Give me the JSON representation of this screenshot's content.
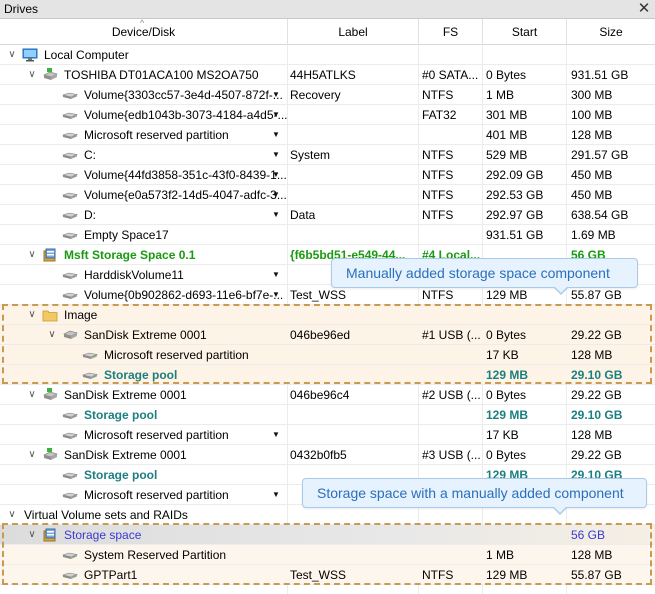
{
  "panel": {
    "title": "Drives"
  },
  "header": {
    "columns": [
      "Device/Disk",
      "Label",
      "FS",
      "Start",
      "Size"
    ]
  },
  "rows": [
    {
      "expand": "collapse",
      "level": 0,
      "icon": "computer-icon",
      "name": "Local Computer",
      "label": "",
      "fs": "",
      "start": "",
      "size": "",
      "style": "",
      "dropdown": false
    },
    {
      "expand": "collapse",
      "level": 1,
      "icon": "disk-green-icon",
      "name": "TOSHIBA DT01ACA100 MS2OA750",
      "label": "44H5ATLKS",
      "fs": "#0 SATA...",
      "start": "0 Bytes",
      "size": "931.51 GB",
      "style": "",
      "dropdown": false
    },
    {
      "expand": "",
      "level": 2,
      "icon": "volume-icon",
      "name": "Volume{3303cc57-3e4d-4507-872f-...",
      "label": "Recovery",
      "fs": "NTFS",
      "start": "1 MB",
      "size": "300 MB",
      "style": "",
      "dropdown": true
    },
    {
      "expand": "",
      "level": 2,
      "icon": "volume-icon",
      "name": "Volume{edb1043b-3073-4184-a4d5-...",
      "label": "",
      "fs": "FAT32",
      "start": "301 MB",
      "size": "100 MB",
      "style": "",
      "dropdown": true
    },
    {
      "expand": "",
      "level": 2,
      "icon": "volume-icon",
      "name": "Microsoft reserved partition",
      "label": "",
      "fs": "",
      "start": "401 MB",
      "size": "128 MB",
      "style": "",
      "dropdown": true
    },
    {
      "expand": "",
      "level": 2,
      "icon": "volume-icon",
      "name": "C:",
      "label": "System",
      "fs": "NTFS",
      "start": "529 MB",
      "size": "291.57 GB",
      "style": "",
      "dropdown": true
    },
    {
      "expand": "",
      "level": 2,
      "icon": "volume-icon",
      "name": "Volume{44fd3858-351c-43f0-8439-1...",
      "label": "",
      "fs": "NTFS",
      "start": "292.09 GB",
      "size": "450 MB",
      "style": "",
      "dropdown": true
    },
    {
      "expand": "",
      "level": 2,
      "icon": "volume-icon",
      "name": "Volume{e0a573f2-14d5-4047-adfc-3...",
      "label": "",
      "fs": "NTFS",
      "start": "292.53 GB",
      "size": "450 MB",
      "style": "",
      "dropdown": true
    },
    {
      "expand": "",
      "level": 2,
      "icon": "volume-icon",
      "name": "D:",
      "label": "Data",
      "fs": "NTFS",
      "start": "292.97 GB",
      "size": "638.54 GB",
      "style": "",
      "dropdown": true
    },
    {
      "expand": "",
      "level": 2,
      "icon": "volume-icon",
      "name": "Empty Space17",
      "label": "",
      "fs": "",
      "start": "931.51 GB",
      "size": "1.69 MB",
      "style": "",
      "dropdown": false
    },
    {
      "expand": "collapse",
      "level": 1,
      "icon": "storage-space-icon",
      "name": "Msft Storage Space 0.1",
      "label": "{f6b5bd51-e549-44...",
      "fs": "#4 Local...",
      "start": "",
      "size": "56 GB",
      "style": "green",
      "dropdown": false
    },
    {
      "expand": "",
      "level": 2,
      "icon": "volume-icon",
      "name": "HarddiskVolume11",
      "label": "",
      "fs": "",
      "start": "",
      "size": "",
      "style": "",
      "dropdown": true
    },
    {
      "expand": "",
      "level": 2,
      "icon": "volume-icon",
      "name": "Volume{0b902862-d693-11e6-bf7e-...",
      "label": "Test_WSS",
      "fs": "NTFS",
      "start": "129 MB",
      "size": "55.87 GB",
      "style": "",
      "dropdown": true
    },
    {
      "expand": "collapse",
      "level": 1,
      "icon": "folder-icon",
      "name": "Image",
      "label": "",
      "fs": "",
      "start": "",
      "size": "",
      "style": "",
      "dropdown": false
    },
    {
      "expand": "collapse",
      "level": 2,
      "icon": "disk-icon",
      "name": "SanDisk Extreme 0001",
      "label": "046be96ed",
      "fs": "#1 USB (...",
      "start": "0 Bytes",
      "size": "29.22 GB",
      "style": "",
      "dropdown": false
    },
    {
      "expand": "",
      "level": 3,
      "icon": "volume-icon",
      "name": "Microsoft reserved partition",
      "label": "",
      "fs": "",
      "start": "17 KB",
      "size": "128 MB",
      "style": "",
      "dropdown": false
    },
    {
      "expand": "",
      "level": 3,
      "icon": "volume-icon",
      "name": "Storage pool",
      "label": "",
      "fs": "",
      "start": "129 MB",
      "size": "29.10 GB",
      "style": "teal",
      "dropdown": false
    },
    {
      "expand": "collapse",
      "level": 1,
      "icon": "disk-green-icon",
      "name": "SanDisk Extreme 0001",
      "label": "046be96c4",
      "fs": "#2 USB (...",
      "start": "0 Bytes",
      "size": "29.22 GB",
      "style": "",
      "dropdown": false
    },
    {
      "expand": "",
      "level": 2,
      "icon": "volume-icon",
      "name": "Storage pool",
      "label": "",
      "fs": "",
      "start": "129 MB",
      "size": "29.10 GB",
      "style": "teal",
      "dropdown": false
    },
    {
      "expand": "",
      "level": 2,
      "icon": "volume-icon",
      "name": "Microsoft reserved partition",
      "label": "",
      "fs": "",
      "start": "17 KB",
      "size": "128 MB",
      "style": "",
      "dropdown": true
    },
    {
      "expand": "collapse",
      "level": 1,
      "icon": "disk-green-icon",
      "name": "SanDisk Extreme 0001",
      "label": "0432b0fb5",
      "fs": "#3 USB (...",
      "start": "0 Bytes",
      "size": "29.22 GB",
      "style": "",
      "dropdown": false
    },
    {
      "expand": "",
      "level": 2,
      "icon": "volume-icon",
      "name": "Storage pool",
      "label": "",
      "fs": "",
      "start": "129 MB",
      "size": "29.10 GB",
      "style": "teal",
      "dropdown": false
    },
    {
      "expand": "",
      "level": 2,
      "icon": "volume-icon",
      "name": "Microsoft reserved partition",
      "label": "",
      "fs": "",
      "start": "17 KB",
      "size": "128 MB",
      "style": "",
      "dropdown": true
    },
    {
      "expand": "collapse",
      "level": 0,
      "icon": "",
      "name": "Virtual Volume sets and RAIDs",
      "label": "",
      "fs": "",
      "start": "",
      "size": "",
      "style": "",
      "dropdown": false
    },
    {
      "expand": "collapse",
      "level": 1,
      "icon": "storage-space-icon",
      "name": "Storage space",
      "label": "",
      "fs": "",
      "start": "",
      "size": "56 GB",
      "style": "blue",
      "dropdown": false
    },
    {
      "expand": "",
      "level": 2,
      "icon": "volume-icon",
      "name": "System Reserved Partition",
      "label": "",
      "fs": "",
      "start": "1 MB",
      "size": "128 MB",
      "style": "",
      "dropdown": false
    },
    {
      "expand": "",
      "level": 2,
      "icon": "volume-icon",
      "name": "GPTPart1",
      "label": "Test_WSS",
      "fs": "NTFS",
      "start": "129 MB",
      "size": "55.87 GB",
      "style": "",
      "dropdown": false
    }
  ],
  "callouts": {
    "manual_component": "Manually added storage space component",
    "space_with_component": "Storage space with a manually added component"
  },
  "colors": {
    "green_text": "#1a9a10",
    "teal_text": "#1c7f7f",
    "blue_text": "#3a3ad0",
    "highlight": "#fdf3e6",
    "dashed_border": "#c99a52",
    "callout_bg": "#e6f2fd",
    "callout_text": "#2a6fbb"
  }
}
